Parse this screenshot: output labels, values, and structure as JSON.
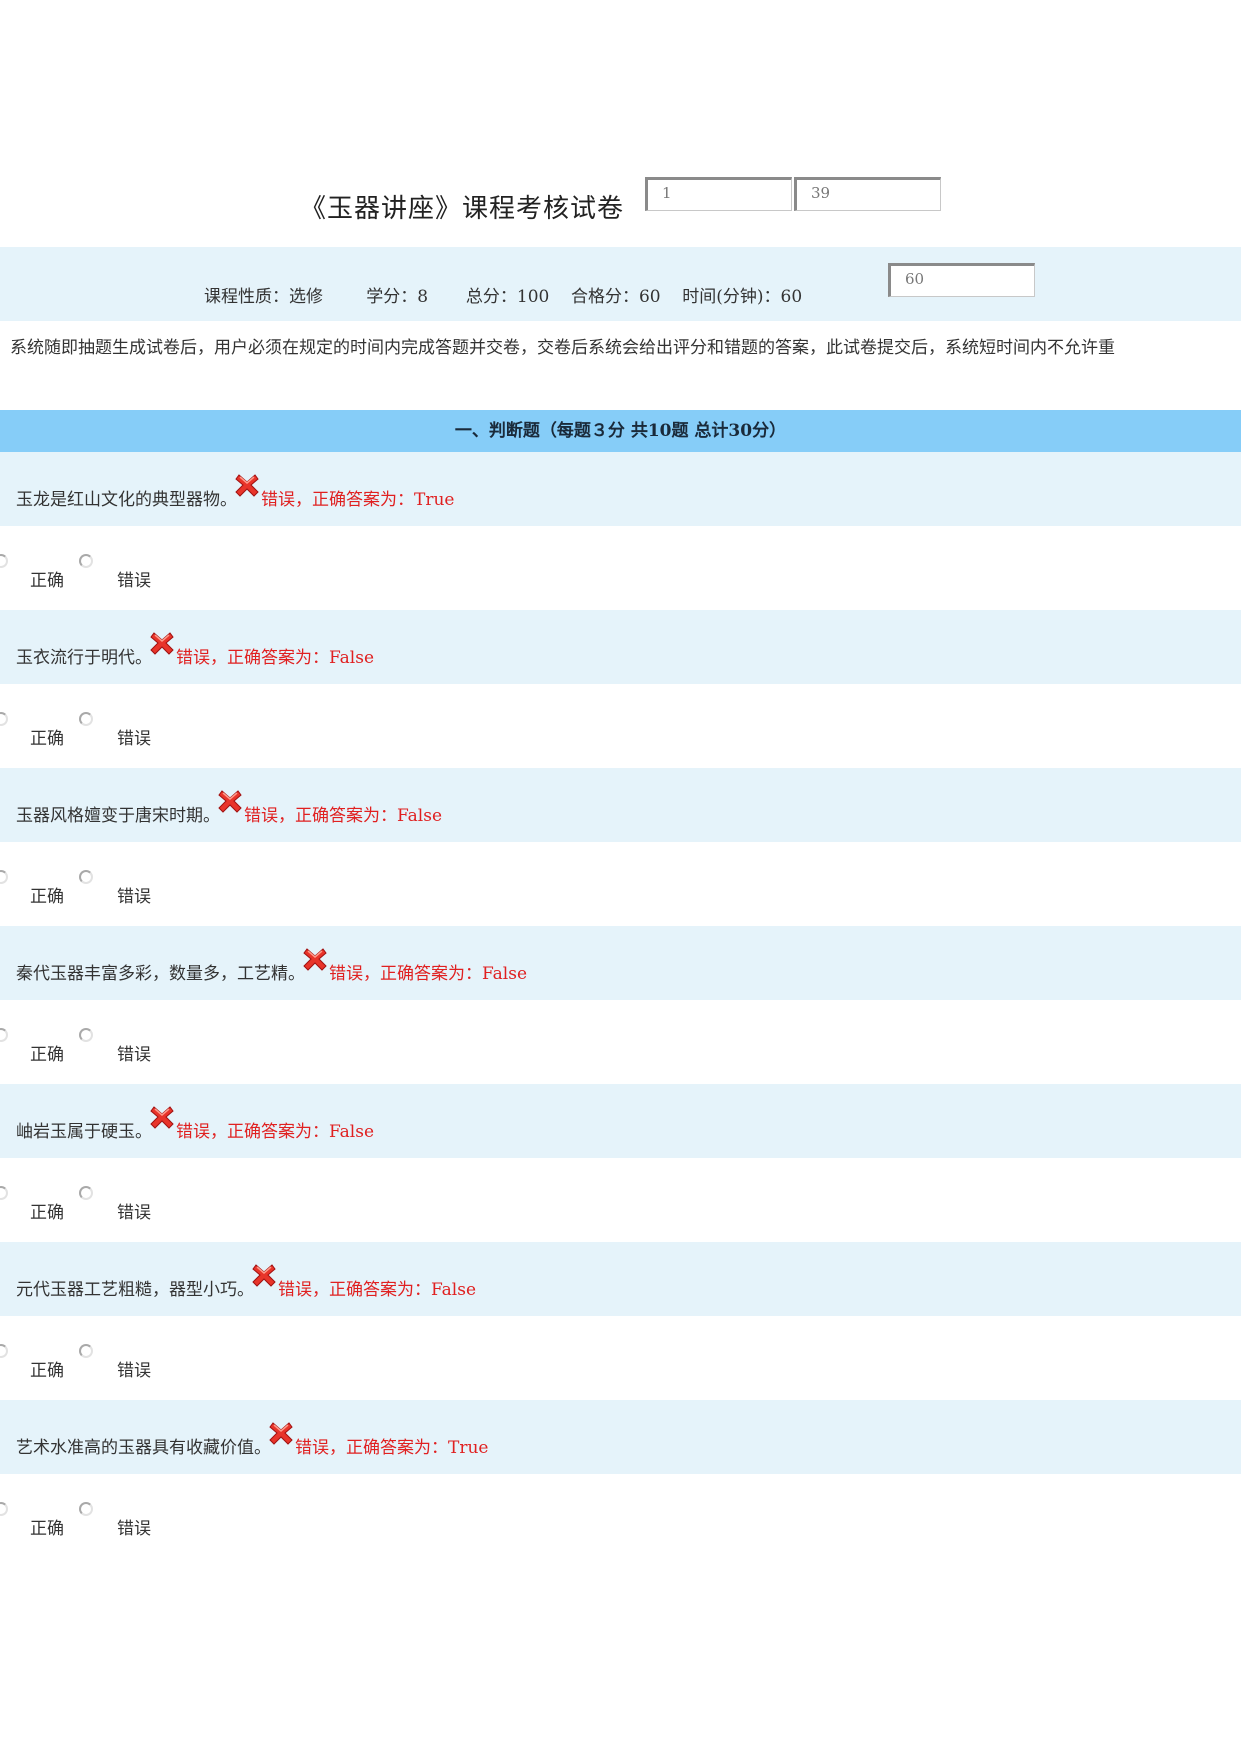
{
  "header": {
    "title": "《玉器讲座》课程考核试卷",
    "box1_value": "1",
    "box2_value": "39"
  },
  "info": {
    "course_type_label": "课程性质：选修",
    "credit_label": "学分：8",
    "total_label": "总分：100",
    "pass_label": "合格分：60",
    "time_label": "时间(分钟)：60",
    "time_box_value": "60"
  },
  "notice": "：系统随即抽题生成试卷后，用户必须在规定的时间内完成答题并交卷，交卷后系统会给出评分和错题的答案，此试卷提交后，系统短时间内不允许重",
  "section": {
    "title": "一、判断题（每题３分 共10题 总计30分）"
  },
  "options": {
    "true_label": "正确",
    "false_label": "错误"
  },
  "colors": {
    "band": "#e5f3fa",
    "section_header": "#86cdf8",
    "error_text": "#e02020"
  },
  "questions": [
    {
      "text": "玉龙是红山文化的典型器物。",
      "result": "错误，正确答案为：True",
      "icon": "red-x-icon"
    },
    {
      "text": "玉衣流行于明代。",
      "result": "错误，正确答案为：False",
      "icon": "red-x-icon"
    },
    {
      "text": "玉器风格嬗变于唐宋时期。",
      "result": "错误，正确答案为：False",
      "icon": "red-x-icon"
    },
    {
      "text": "秦代玉器丰富多彩，数量多，工艺精。",
      "result": "错误，正确答案为：False",
      "icon": "red-x-icon"
    },
    {
      "text": "岫岩玉属于硬玉。",
      "result": "错误，正确答案为：False",
      "icon": "red-x-icon"
    },
    {
      "text": "元代玉器工艺粗糙，器型小巧。",
      "result": "错误，正确答案为：False",
      "icon": "red-x-icon"
    },
    {
      "text": "艺术水准高的玉器具有收藏价值。",
      "result": "错误，正确答案为：True",
      "icon": "red-x-icon"
    }
  ]
}
